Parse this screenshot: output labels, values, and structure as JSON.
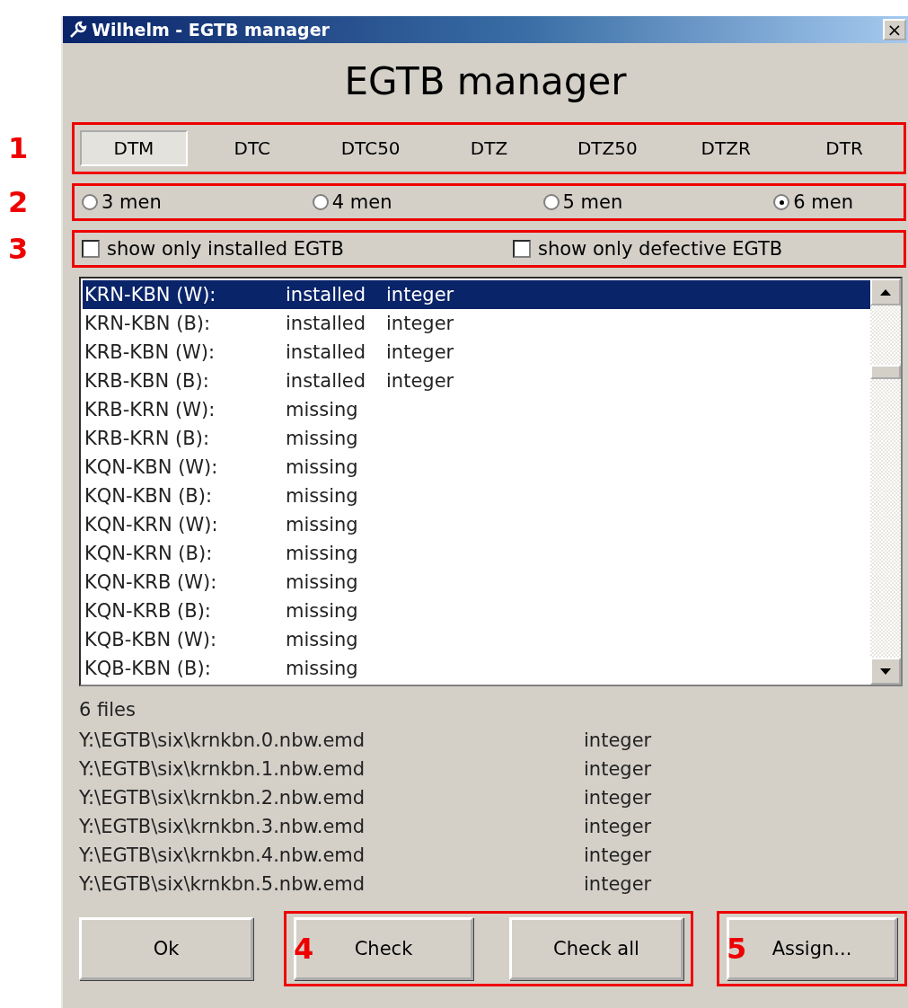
{
  "window": {
    "title": "Wilhelm - EGTB manager",
    "close": "×"
  },
  "heading": "EGTB manager",
  "metrics": {
    "callout": "1",
    "tabs": [
      {
        "label": "DTM",
        "selected": true
      },
      {
        "label": "DTC",
        "selected": false
      },
      {
        "label": "DTC50",
        "selected": false
      },
      {
        "label": "DTZ",
        "selected": false
      },
      {
        "label": "DTZ50",
        "selected": false
      },
      {
        "label": "DTZR",
        "selected": false
      },
      {
        "label": "DTR",
        "selected": false
      }
    ]
  },
  "pieces": {
    "callout": "2",
    "options": [
      {
        "label": "3 men",
        "selected": false
      },
      {
        "label": "4 men",
        "selected": false
      },
      {
        "label": "5 men",
        "selected": false
      },
      {
        "label": "6 men",
        "selected": true
      }
    ]
  },
  "filters": {
    "callout": "3",
    "options": [
      {
        "label": "show only installed EGTB",
        "checked": false
      },
      {
        "label": "show only defective EGTB",
        "checked": false
      }
    ]
  },
  "tables": [
    {
      "name": "KRN-KBN (W):",
      "status": "installed",
      "type": "integer",
      "selected": true
    },
    {
      "name": "KRN-KBN (B):",
      "status": "installed",
      "type": "integer",
      "selected": false
    },
    {
      "name": "KRB-KBN (W):",
      "status": "installed",
      "type": "integer",
      "selected": false
    },
    {
      "name": "KRB-KBN (B):",
      "status": "installed",
      "type": "integer",
      "selected": false
    },
    {
      "name": "KRB-KRN (W):",
      "status": "missing",
      "selected": false
    },
    {
      "name": "KRB-KRN (B):",
      "status": "missing",
      "selected": false
    },
    {
      "name": "KQN-KBN (W):",
      "status": "missing",
      "selected": false
    },
    {
      "name": "KQN-KBN (B):",
      "status": "missing",
      "selected": false
    },
    {
      "name": "KQN-KRN (W):",
      "status": "missing",
      "selected": false
    },
    {
      "name": "KQN-KRN (B):",
      "status": "missing",
      "selected": false
    },
    {
      "name": "KQN-KRB (W):",
      "status": "missing",
      "selected": false
    },
    {
      "name": "KQN-KRB (B):",
      "status": "missing",
      "selected": false
    },
    {
      "name": "KQB-KBN (W):",
      "status": "missing",
      "selected": false
    },
    {
      "name": "KQB-KBN (B):",
      "status": "missing",
      "selected": false
    }
  ],
  "files": {
    "count": "6 files",
    "rows": [
      {
        "path": "Y:\\EGTB\\six\\krnkbn.0.nbw.emd",
        "type": "integer"
      },
      {
        "path": "Y:\\EGTB\\six\\krnkbn.1.nbw.emd",
        "type": "integer"
      },
      {
        "path": "Y:\\EGTB\\six\\krnkbn.2.nbw.emd",
        "type": "integer"
      },
      {
        "path": "Y:\\EGTB\\six\\krnkbn.3.nbw.emd",
        "type": "integer"
      },
      {
        "path": "Y:\\EGTB\\six\\krnkbn.4.nbw.emd",
        "type": "integer"
      },
      {
        "path": "Y:\\EGTB\\six\\krnkbn.5.nbw.emd",
        "type": "integer"
      }
    ]
  },
  "buttons": {
    "ok": "Ok",
    "check_group": {
      "callout": "4",
      "items": [
        "Check",
        "Check all"
      ]
    },
    "assign_group": {
      "callout": "5",
      "items": [
        "Assign..."
      ]
    }
  }
}
